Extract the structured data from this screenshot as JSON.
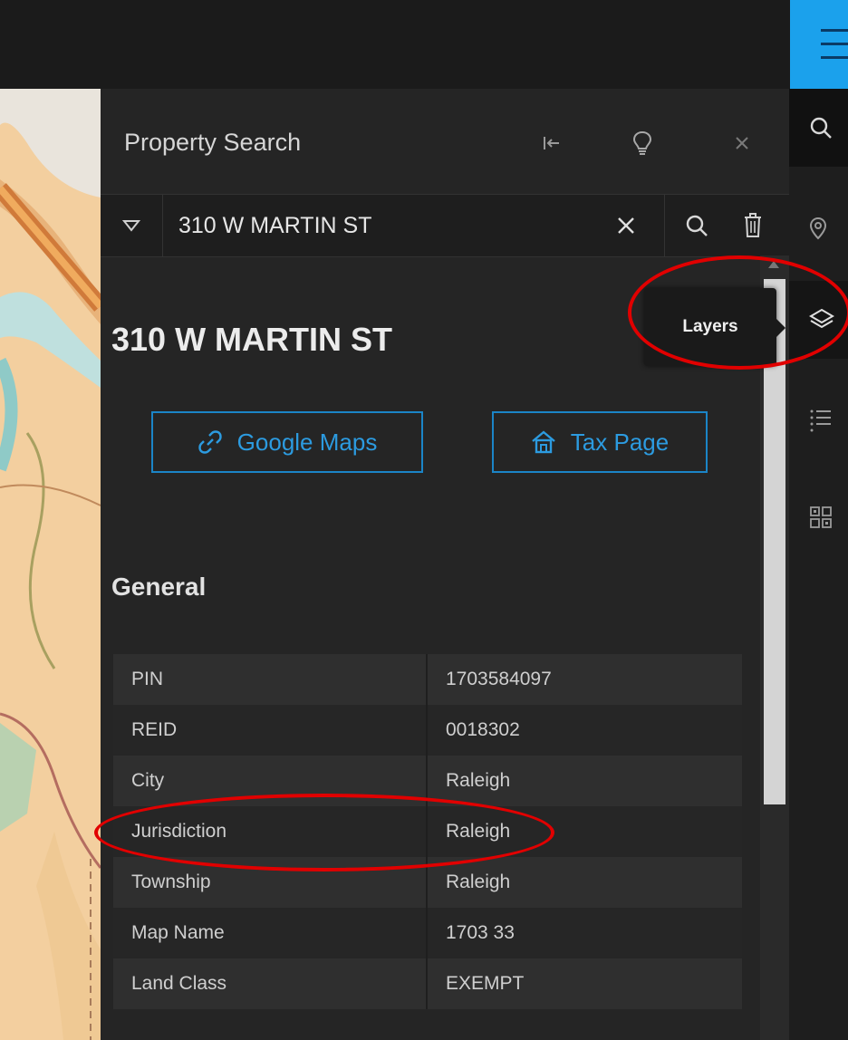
{
  "panel": {
    "title": "Property Search"
  },
  "search": {
    "value": "310 W MARTIN ST"
  },
  "result": {
    "address": "310 W MARTIN ST",
    "google_maps_label": "Google Maps",
    "tax_page_label": "Tax Page",
    "section_title": "General",
    "attributes": [
      {
        "key": "PIN",
        "value": "1703584097"
      },
      {
        "key": "REID",
        "value": "0018302"
      },
      {
        "key": "City",
        "value": "Raleigh"
      },
      {
        "key": "Jurisdiction",
        "value": "Raleigh"
      },
      {
        "key": "Township",
        "value": "Raleigh"
      },
      {
        "key": "Map Name",
        "value": "1703 33"
      },
      {
        "key": "Land Class",
        "value": "EXEMPT"
      }
    ]
  },
  "tooltip": {
    "label": "Layers"
  },
  "colors": {
    "accent": "#1ba1ec",
    "link": "#2c9be0",
    "annotation": "#e10000"
  },
  "icons": [
    "hamburger-icon",
    "dock-icon",
    "lightbulb-icon",
    "close-icon",
    "chevron-down-icon",
    "clear-icon",
    "search-icon",
    "trash-icon",
    "location-icon",
    "layers-icon",
    "list-icon",
    "qr-icon",
    "link-icon",
    "house-icon"
  ]
}
